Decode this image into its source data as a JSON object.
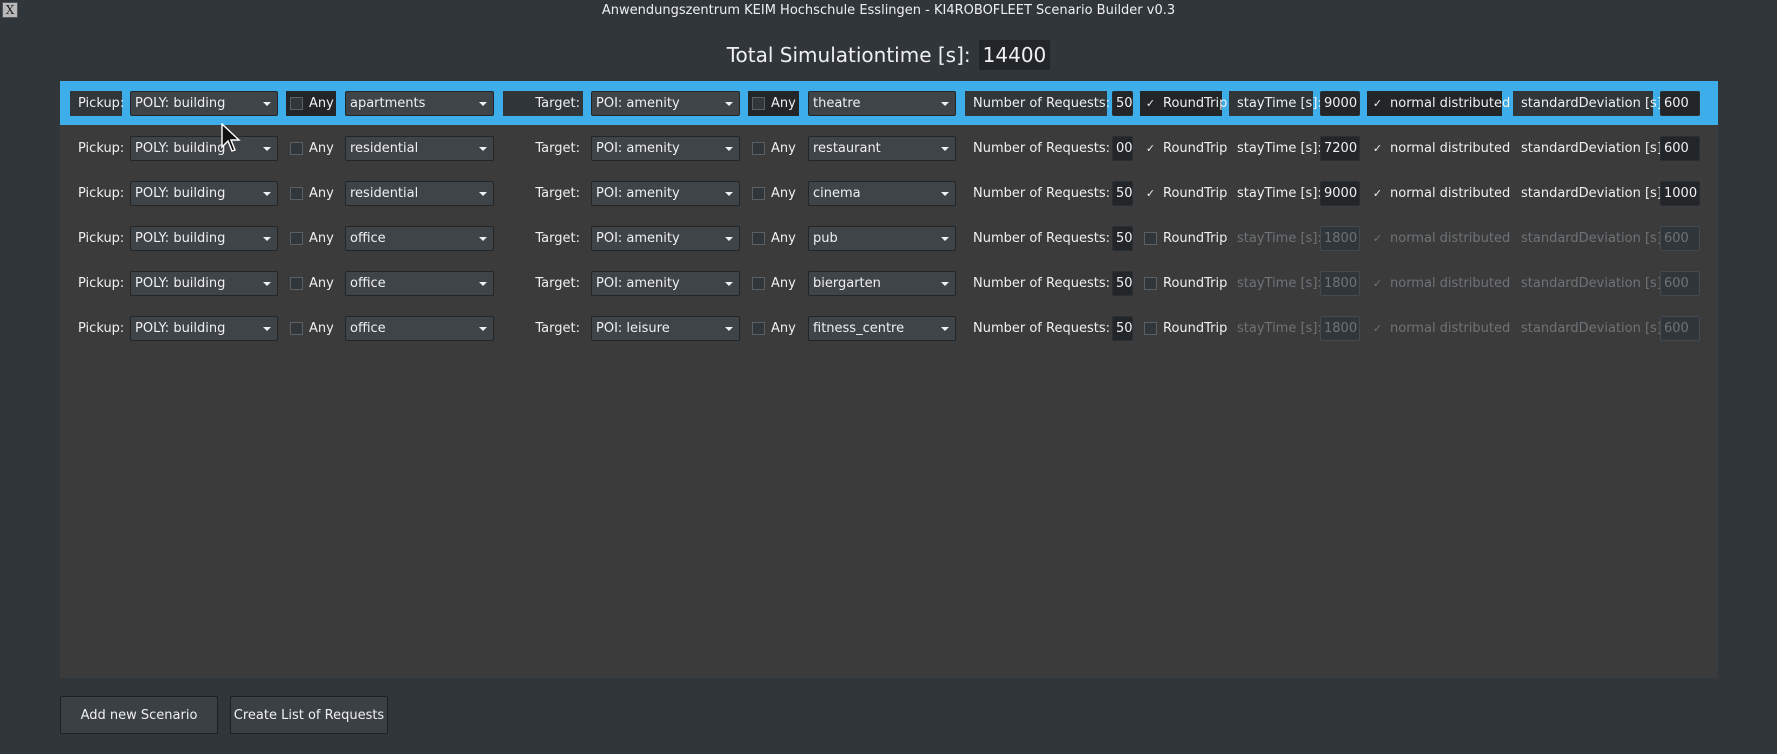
{
  "window": {
    "title": "Anwendungszentrum KEIM Hochschule Esslingen - KI4ROBOFLEET Scenario Builder v0.3",
    "icon": "x-window-icon",
    "icon_glyph": "X"
  },
  "total": {
    "label": "Total Simulationtime [s]:",
    "value": "14400"
  },
  "labels": {
    "pickup": "Pickup:",
    "any": "Any",
    "target": "Target:",
    "num_requests": "Number of Requests:",
    "roundtrip": "RoundTrip",
    "stay_time": "stayTime [s]:",
    "normal": "normal distributed",
    "std_dev": "standardDeviation [s]:",
    "check_glyph": "✓"
  },
  "scenarios": [
    {
      "pickup_type": "POLY: building",
      "pickup_any": false,
      "pickup_value": "apartments",
      "target_type": "POI: amenity",
      "target_any": false,
      "target_value": "theatre",
      "num_requests": "50",
      "roundtrip": true,
      "stay_time": "9000",
      "normal": true,
      "std_dev": "600",
      "selected": true
    },
    {
      "pickup_type": "POLY: building",
      "pickup_any": false,
      "pickup_value": "residential",
      "target_type": "POI: amenity",
      "target_any": false,
      "target_value": "restaurant",
      "num_requests": "00",
      "roundtrip": true,
      "stay_time": "7200",
      "normal": true,
      "std_dev": "600",
      "selected": false
    },
    {
      "pickup_type": "POLY: building",
      "pickup_any": false,
      "pickup_value": "residential",
      "target_type": "POI: amenity",
      "target_any": false,
      "target_value": "cinema",
      "num_requests": "50",
      "roundtrip": true,
      "stay_time": "9000",
      "normal": true,
      "std_dev": "1000",
      "selected": false
    },
    {
      "pickup_type": "POLY: building",
      "pickup_any": false,
      "pickup_value": "office",
      "target_type": "POI: amenity",
      "target_any": false,
      "target_value": "pub",
      "num_requests": "50",
      "roundtrip": false,
      "stay_time": "1800",
      "normal": true,
      "std_dev": "600",
      "selected": false
    },
    {
      "pickup_type": "POLY: building",
      "pickup_any": false,
      "pickup_value": "office",
      "target_type": "POI: amenity",
      "target_any": false,
      "target_value": "biergarten",
      "num_requests": "50",
      "roundtrip": false,
      "stay_time": "1800",
      "normal": true,
      "std_dev": "600",
      "selected": false
    },
    {
      "pickup_type": "POLY: building",
      "pickup_any": false,
      "pickup_value": "office",
      "target_type": "POI: leisure",
      "target_any": false,
      "target_value": "fitness_centre",
      "num_requests": "50",
      "roundtrip": false,
      "stay_time": "1800",
      "normal": true,
      "std_dev": "600",
      "selected": false
    }
  ],
  "buttons": {
    "add": "Add new Scenario",
    "create": "Create List of Requests"
  },
  "colors": {
    "selection": "#3daee9",
    "background": "#31363b",
    "panel": "#3b3b3b"
  }
}
